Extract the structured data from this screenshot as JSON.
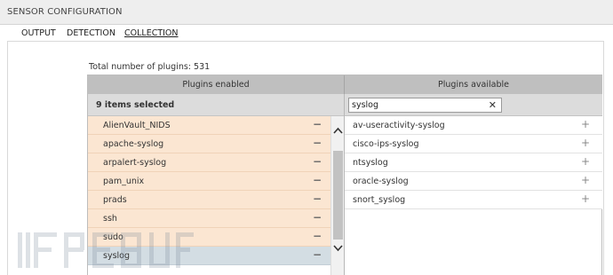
{
  "window": {
    "title": "SENSOR CONFIGURATION"
  },
  "tabs": [
    {
      "label": "OUTPUT",
      "active": false
    },
    {
      "label": "DETECTION",
      "active": false
    },
    {
      "label": "COLLECTION",
      "active": true
    }
  ],
  "plugins": {
    "total_text": "Total number of plugins: 531",
    "enabled_header": "Plugins enabled",
    "available_header": "Plugins available",
    "selected_count": "9 items selected",
    "search": {
      "value": "syslog",
      "clear_icon": "close-icon"
    },
    "enabled": [
      {
        "name": "AlienVault_NIDS",
        "selected": false
      },
      {
        "name": "apache-syslog",
        "selected": false
      },
      {
        "name": "arpalert-syslog",
        "selected": false
      },
      {
        "name": "pam_unix",
        "selected": false
      },
      {
        "name": "prads",
        "selected": false
      },
      {
        "name": "ssh",
        "selected": false
      },
      {
        "name": "sudo",
        "selected": false
      },
      {
        "name": "syslog",
        "selected": true
      }
    ],
    "available": [
      {
        "name": "av-useractivity-syslog"
      },
      {
        "name": "cisco-ips-syslog"
      },
      {
        "name": "ntsyslog"
      },
      {
        "name": "oracle-syslog"
      },
      {
        "name": "snort_syslog"
      }
    ],
    "remove_symbol": "−",
    "add_symbol": "+"
  },
  "colors": {
    "enabled_row": "#fbe6d2",
    "selected_row": "#d3dde3",
    "header_bg": "#bfbfbf"
  },
  "icons": {
    "scroll_up": "chevron-up-icon",
    "scroll_down": "chevron-down-icon",
    "remove": "minus-icon",
    "add": "plus-icon"
  }
}
